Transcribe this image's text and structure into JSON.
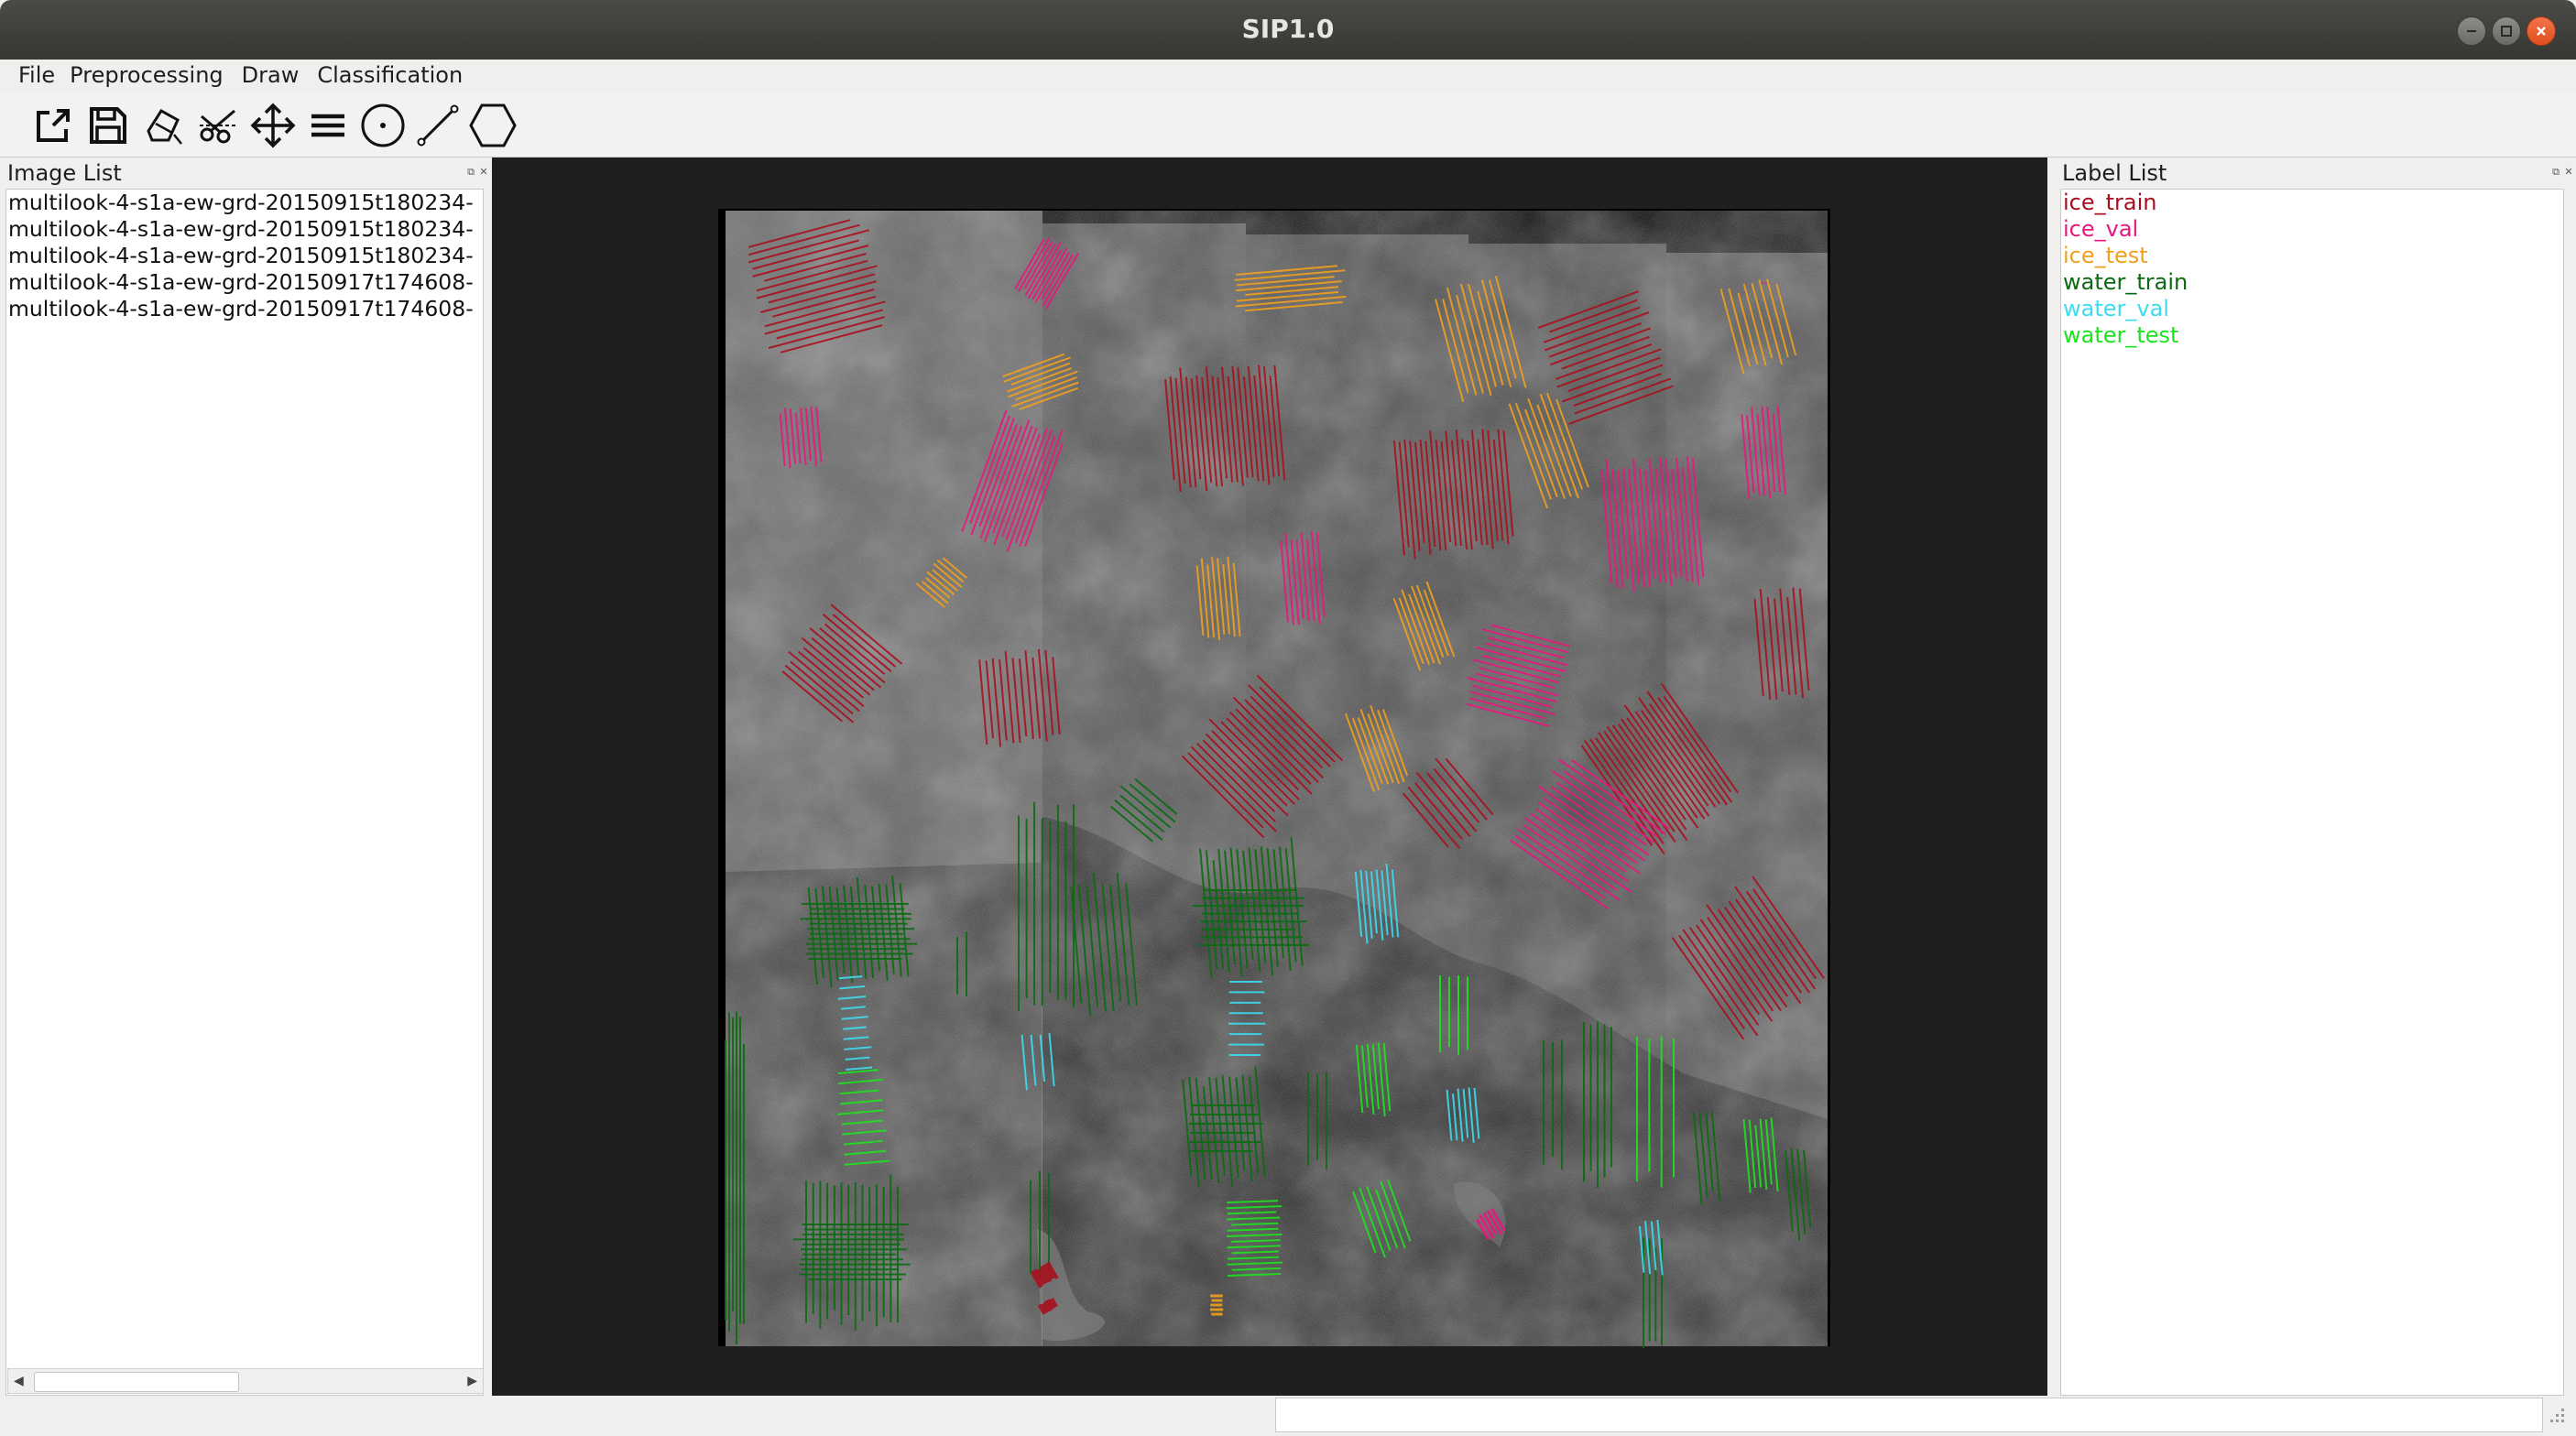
{
  "window": {
    "title": "SIP1.0"
  },
  "menu": {
    "items": [
      "File",
      "Preprocessing",
      "Draw",
      "Classification"
    ]
  },
  "toolbar": {
    "tools": [
      {
        "icon": "open-external-icon"
      },
      {
        "icon": "save-icon"
      },
      {
        "icon": "eraser-icon"
      },
      {
        "icon": "scissors-icon"
      },
      {
        "icon": "move-icon"
      },
      {
        "icon": "lines-icon"
      },
      {
        "icon": "point-circle-icon"
      },
      {
        "icon": "line-segment-icon"
      },
      {
        "icon": "hexagon-icon"
      }
    ]
  },
  "image_list": {
    "title": "Image List",
    "items": [
      "multilook-4-s1a-ew-grd-20150915t180234-",
      "multilook-4-s1a-ew-grd-20150915t180234-",
      "multilook-4-s1a-ew-grd-20150915t180234-",
      "multilook-4-s1a-ew-grd-20150917t174608-",
      "multilook-4-s1a-ew-grd-20150917t174608-"
    ]
  },
  "label_list": {
    "title": "Label List",
    "items": [
      {
        "name": "ice_train",
        "color": "#a80f1e"
      },
      {
        "name": "ice_val",
        "color": "#e8177e"
      },
      {
        "name": "ice_test",
        "color": "#f0a01e"
      },
      {
        "name": "water_train",
        "color": "#0b6b12"
      },
      {
        "name": "water_val",
        "color": "#3cdcf0"
      },
      {
        "name": "water_test",
        "color": "#1ee21e"
      }
    ]
  },
  "status": {
    "message": "",
    "field": ""
  }
}
